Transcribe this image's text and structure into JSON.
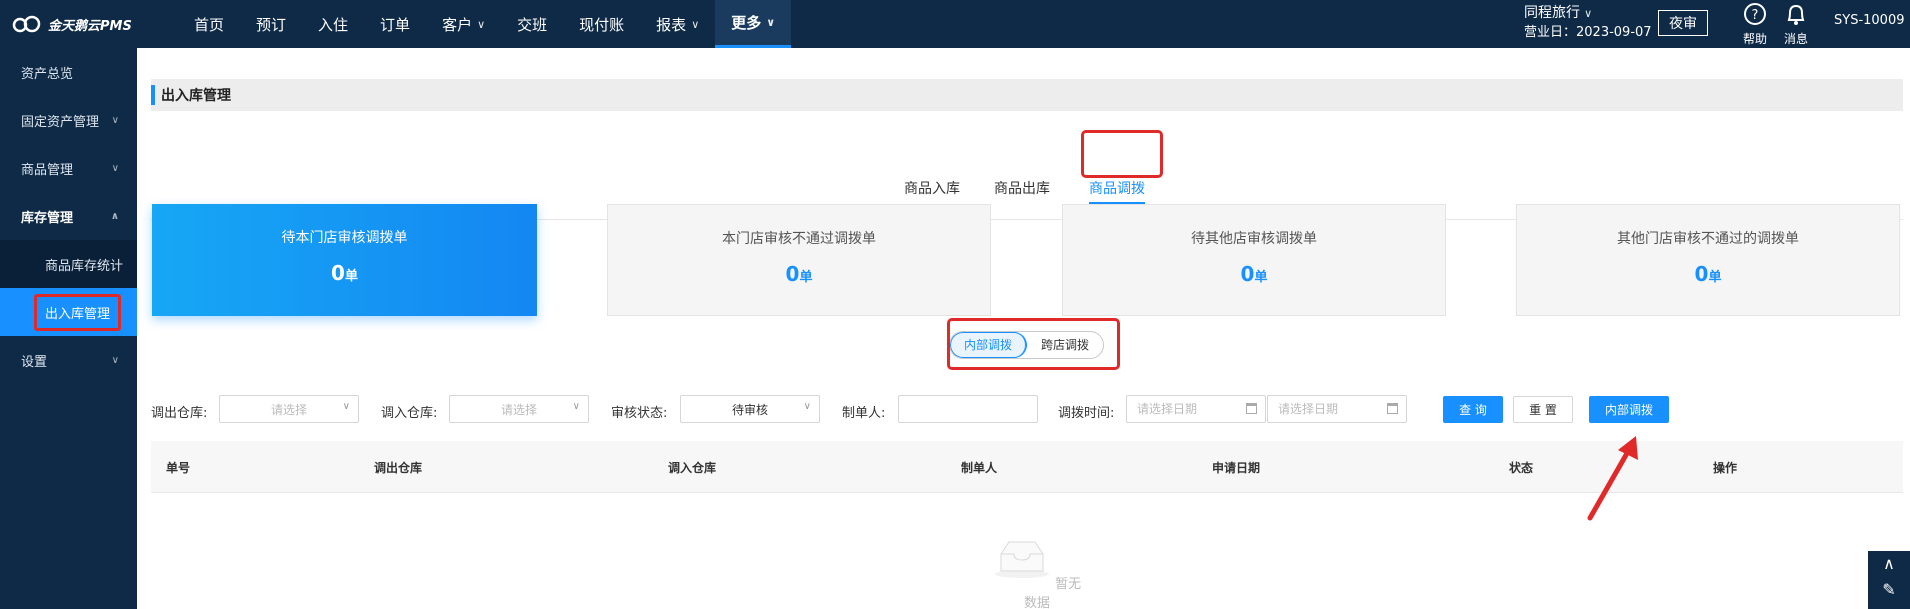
{
  "header": {
    "logo_text": "金天鹅云PMS",
    "nav": [
      {
        "label": "首页",
        "caret": false,
        "active": false
      },
      {
        "label": "预订",
        "caret": false,
        "active": false
      },
      {
        "label": "入住",
        "caret": false,
        "active": false
      },
      {
        "label": "订单",
        "caret": false,
        "active": false
      },
      {
        "label": "客户",
        "caret": true,
        "active": false
      },
      {
        "label": "交班",
        "caret": false,
        "active": false
      },
      {
        "label": "现付账",
        "caret": false,
        "active": false
      },
      {
        "label": "报表",
        "caret": true,
        "active": false
      },
      {
        "label": "更多",
        "caret": true,
        "active": true
      }
    ],
    "hotel_name": "同程旅行",
    "business_date": "营业日：2023-09-07",
    "night_audit_label": "夜审",
    "help_label": "帮助",
    "message_label": "消息",
    "user": "SYS-10009",
    "help_icon": "question-circle-icon",
    "message_icon": "bell-icon"
  },
  "sidebar": {
    "items": [
      {
        "label": "资产总览",
        "chevron": "",
        "open": false
      },
      {
        "label": "固定资产管理",
        "chevron": "down",
        "open": false
      },
      {
        "label": "商品管理",
        "chevron": "down",
        "open": false
      },
      {
        "label": "库存管理",
        "chevron": "up",
        "open": true
      }
    ],
    "sub_items": [
      {
        "label": "商品库存统计",
        "active": false
      },
      {
        "label": "出入库管理",
        "active": true
      }
    ],
    "settings_label": "设置"
  },
  "page": {
    "title": "出入库管理",
    "tabs": [
      {
        "label": "商品入库",
        "active": false
      },
      {
        "label": "商品出库",
        "active": false
      },
      {
        "label": "商品调拨",
        "active": true
      }
    ],
    "cards": [
      {
        "title": "待本门店审核调拨单",
        "count": "0",
        "unit": "单",
        "active": true
      },
      {
        "title": "本门店审核不通过调拨单",
        "count": "0",
        "unit": "单",
        "active": false
      },
      {
        "title": "待其他店审核调拨单",
        "count": "0",
        "unit": "单",
        "active": false
      },
      {
        "title": "其他门店审核不通过的调拨单",
        "count": "0",
        "unit": "单",
        "active": false
      }
    ],
    "segments": [
      {
        "label": "内部调拨",
        "active": true
      },
      {
        "label": "跨店调拨",
        "active": false
      }
    ]
  },
  "filters": {
    "out_warehouse_label": "调出仓库:",
    "out_warehouse_placeholder": "请选择",
    "in_warehouse_label": "调入仓库:",
    "in_warehouse_placeholder": "请选择",
    "status_label": "审核状态:",
    "status_value": "待审核",
    "creator_label": "制单人:",
    "creator_value": "",
    "time_label": "调拨时间:",
    "date_start_placeholder": "请选择日期",
    "date_end_placeholder": "请选择日期",
    "query_button": "查 询",
    "reset_button": "重 置",
    "internal_transfer_button": "内部调拨"
  },
  "table": {
    "columns": [
      "单号",
      "调出仓库",
      "调入仓库",
      "制单人",
      "申请日期",
      "状态",
      "操作"
    ],
    "rows": [],
    "empty_text": "暂无数据"
  },
  "colors": {
    "header_bg": "#0e2a47",
    "accent": "#1890ff",
    "highlight_red": "#e02a2a"
  }
}
